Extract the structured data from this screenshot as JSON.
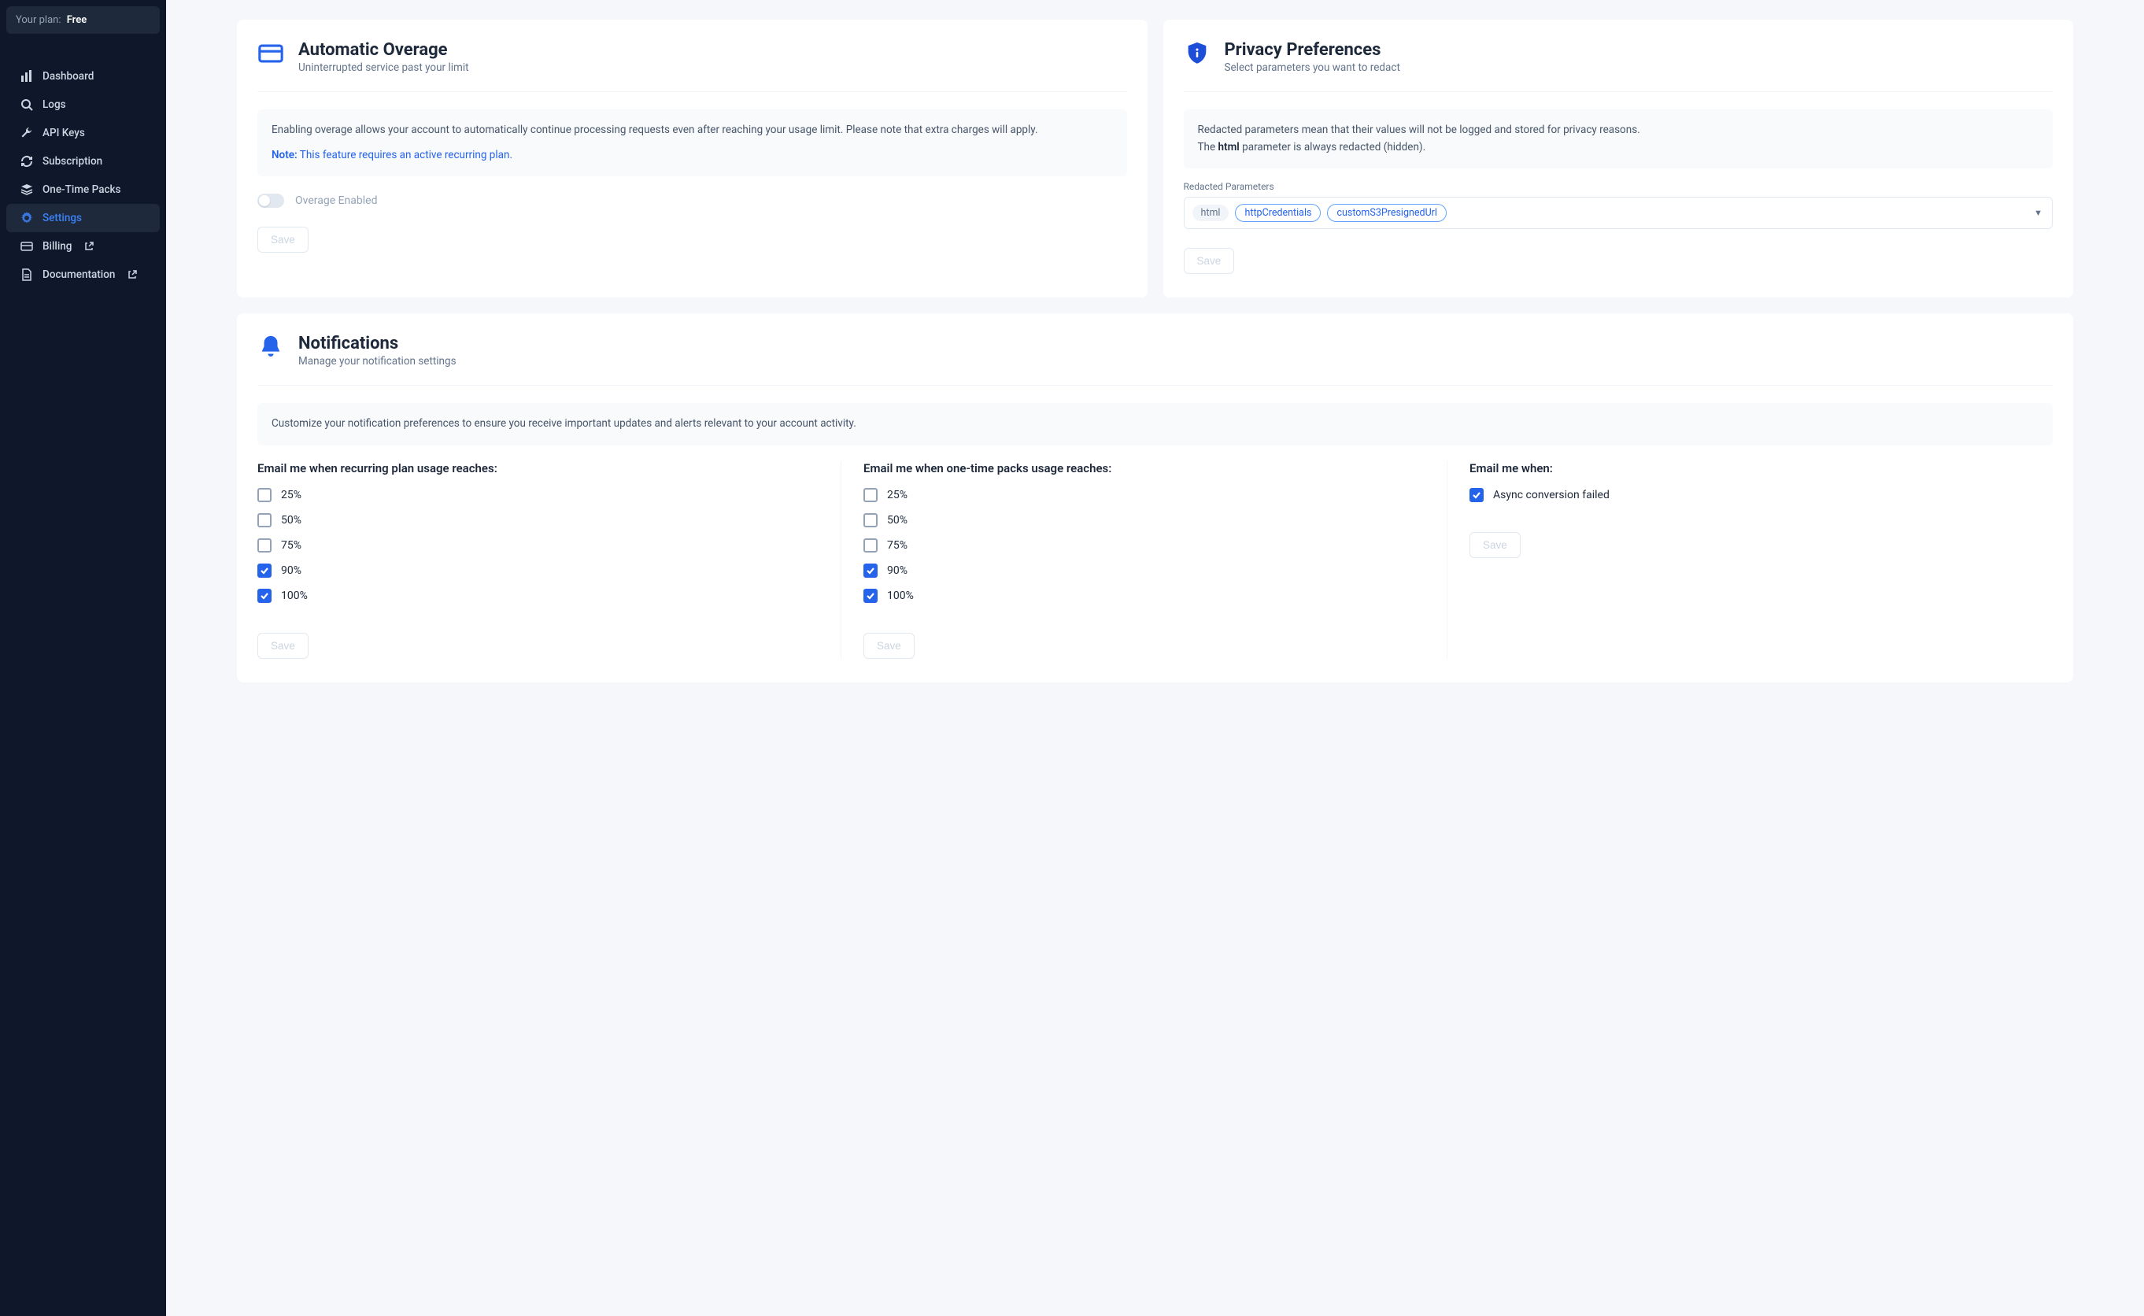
{
  "sidebar": {
    "plan_label": "Your plan:",
    "plan_value": "Free",
    "items": [
      {
        "key": "dashboard",
        "label": "Dashboard",
        "icon": "bars-icon"
      },
      {
        "key": "logs",
        "label": "Logs",
        "icon": "search-icon"
      },
      {
        "key": "api-keys",
        "label": "API Keys",
        "icon": "wrench-icon"
      },
      {
        "key": "subscription",
        "label": "Subscription",
        "icon": "refresh-icon"
      },
      {
        "key": "one-time-packs",
        "label": "One-Time Packs",
        "icon": "stack-icon"
      },
      {
        "key": "settings",
        "label": "Settings",
        "icon": "gear-icon"
      },
      {
        "key": "billing",
        "label": "Billing",
        "icon": "card-icon",
        "ext": true
      },
      {
        "key": "documentation",
        "label": "Documentation",
        "icon": "doc-icon",
        "ext": true
      }
    ],
    "active": "settings"
  },
  "overage": {
    "title": "Automatic Overage",
    "subtitle": "Uninterrupted service past your limit",
    "info": "Enabling overage allows your account to automatically continue processing requests even after reaching your usage limit. Please note that extra charges will apply.",
    "note_label": "Note:",
    "note_text": "This feature requires an active recurring plan.",
    "toggle_label": "Overage Enabled",
    "save": "Save"
  },
  "privacy": {
    "title": "Privacy Preferences",
    "subtitle": "Select parameters you want to redact",
    "info_line1": "Redacted parameters mean that their values will not be logged and stored for privacy reasons.",
    "info_line2_pre": "The ",
    "info_line2_bold": "html",
    "info_line2_post": " parameter is always redacted (hidden).",
    "param_label": "Redacted Parameters",
    "locked_chip": "html",
    "chips": [
      "httpCredentials",
      "customS3PresignedUrl"
    ],
    "save": "Save"
  },
  "notifications": {
    "title": "Notifications",
    "subtitle": "Manage your notification settings",
    "info": "Customize your notification preferences to ensure you receive important updates and alerts relevant to your account activity.",
    "col1_heading": "Email me when recurring plan usage reaches:",
    "col2_heading": "Email me when one-time packs usage reaches:",
    "col3_heading": "Email me when:",
    "thresholds": [
      {
        "label": "25%",
        "col1": false,
        "col2": false
      },
      {
        "label": "50%",
        "col1": false,
        "col2": false
      },
      {
        "label": "75%",
        "col1": false,
        "col2": false
      },
      {
        "label": "90%",
        "col1": true,
        "col2": true
      },
      {
        "label": "100%",
        "col1": true,
        "col2": true
      }
    ],
    "events": [
      {
        "label": "Async conversion failed",
        "checked": true
      }
    ],
    "save": "Save"
  }
}
